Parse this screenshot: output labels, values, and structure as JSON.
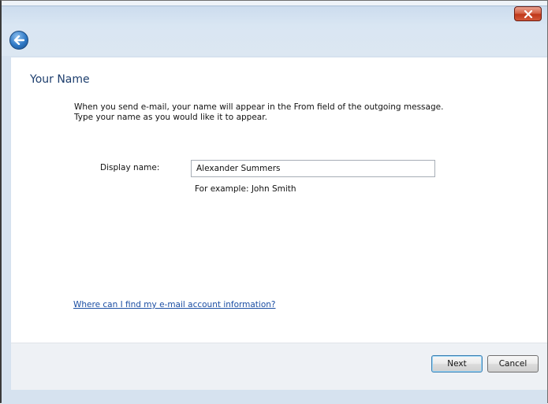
{
  "window": {
    "close_icon": "close-icon",
    "back_icon": "back-arrow-icon",
    "accent_color": "#1e3f6e"
  },
  "page": {
    "heading": "Your Name",
    "description_line1": "When you send e-mail, your name will appear in the From field of the outgoing message.",
    "description_line2": "Type your name as you would like it to appear."
  },
  "form": {
    "display_name_label": "Display name:",
    "display_name_value": "Alexander Summers",
    "example_text": "For example: John Smith"
  },
  "links": {
    "help": "Where can I find my e-mail account information?"
  },
  "buttons": {
    "next": "Next",
    "cancel": "Cancel"
  }
}
